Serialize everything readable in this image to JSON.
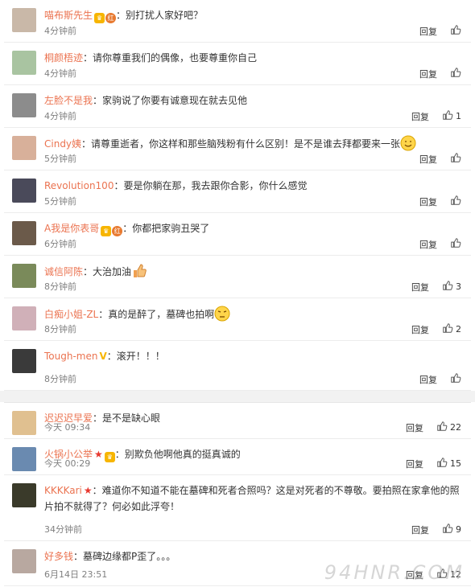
{
  "reply_label": "回复",
  "colors": {
    "name": "#eb7350",
    "time": "#808080",
    "badge_vip": "#f7b500",
    "badge_star": "#e8382f"
  },
  "panel1": [
    {
      "name": "喵布斯先生",
      "badges": [
        "vip",
        "hong"
      ],
      "text": "：别打扰人家好吧？",
      "time": "4分钟前",
      "likes": ""
    },
    {
      "name": "桐颜梧迹",
      "badges": [],
      "text": "：请你尊重我们的偶像，也要尊重你自己",
      "time": "4分钟前",
      "likes": ""
    },
    {
      "name": "左脸不是我",
      "badges": [],
      "text": "：家驹说了你要有诚意现在就去见他",
      "time": "4分钟前",
      "likes": "1"
    },
    {
      "name": "Cindy姨",
      "badges": [],
      "text": "：请尊重逝者，你这样和那些脑残粉有什么区别！是不是谁去拜都要来一张",
      "time": "5分钟前",
      "likes": "",
      "emoji": "smile-emoji"
    },
    {
      "name": "Revolution100",
      "badges": [],
      "text": "：要是你躺在那，我去跟你合影，你什么感觉",
      "time": "5分钟前",
      "likes": ""
    },
    {
      "name": "A我是你表哥",
      "badges": [
        "vip",
        "hong"
      ],
      "text": "：你都把家驹丑哭了",
      "time": "6分钟前",
      "likes": ""
    },
    {
      "name": "诚信阿陈",
      "badges": [],
      "text": "：大治加油",
      "time": "8分钟前",
      "likes": "3",
      "emoji": "thumbs-up-emoji"
    },
    {
      "name": "白痴小姐-ZL",
      "badges": [],
      "text": "：真的是醉了，墓碑也拍啊",
      "time": "8分钟前",
      "likes": "2",
      "emoji": "annoyed-emoji"
    },
    {
      "name": "Tough-men",
      "badges": [
        "v"
      ],
      "text": "：滚开！！！",
      "time": "8分钟前",
      "likes": ""
    }
  ],
  "panel2": [
    {
      "name": "迟迟迟早爱",
      "badges": [],
      "text": "：是不是缺心眼",
      "time": "今天 09:34",
      "likes": "22"
    },
    {
      "name": "火锅小公举",
      "badges": [
        "star",
        "vip"
      ],
      "text": "：别欺负他啊他真的挺真诚的",
      "time": "今天 00:29",
      "likes": "15"
    },
    {
      "name": "KKKKari",
      "badges": [
        "star"
      ],
      "text": "：难道你不知道不能在墓碑和死者合照吗？这是对死者的不尊敬。要拍照在家拿他的照片拍不就得了？何必如此浮夸！",
      "time": "34分钟前",
      "likes": "9"
    },
    {
      "name": "好多钱",
      "badges": [],
      "text": "：墓碑边缘都P歪了。。。",
      "time": "6月14日 23:51",
      "likes": "12"
    }
  ],
  "watermark": "94HNR.COM"
}
